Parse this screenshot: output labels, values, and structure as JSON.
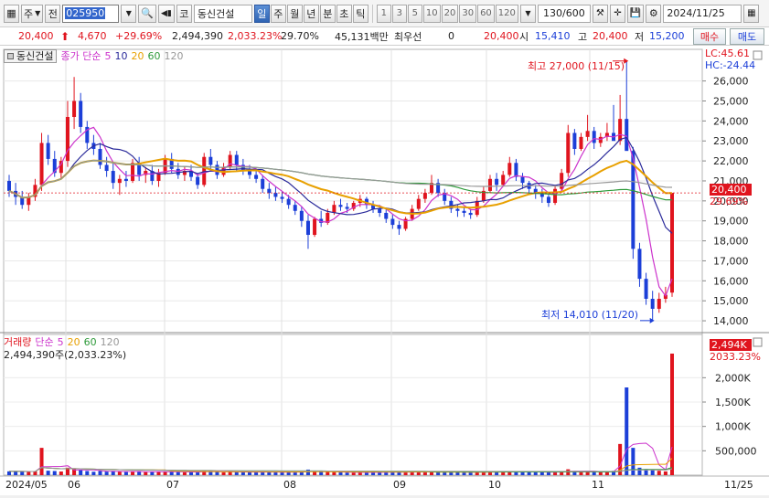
{
  "toolbar": {
    "market_label": "주",
    "prev_label": "전",
    "stock_code": "025950",
    "stock_name": "동신건설",
    "code_label": "코",
    "periods": [
      "일",
      "주",
      "월",
      "년",
      "분",
      "초",
      "틱"
    ],
    "active_period": "일",
    "intervals": [
      "1",
      "3",
      "5",
      "10",
      "20",
      "30",
      "60",
      "120"
    ],
    "count": "130/600",
    "date": "2024/11/25"
  },
  "quote": {
    "price": "20,400",
    "change": "4,670",
    "change_pct": "+29.69%",
    "volume": "2,494,390",
    "volume_ratio": "2,033.23%",
    "turnover": "29.70%",
    "amount": "45,131백만",
    "pref_label": "최우선",
    "pref_value": "0",
    "price_ref": "20,400",
    "open_label": "시",
    "open": "15,410",
    "high_label": "고",
    "high": "20,400",
    "low_label": "저",
    "low": "15,200",
    "buy_label": "매수",
    "sell_label": "매도"
  },
  "price_panel": {
    "legend_name": "동신건설",
    "legend_type": "종가 단순",
    "ma_periods": [
      "5",
      "10",
      "20",
      "60",
      "120"
    ],
    "lc_label": "LC:45.61",
    "hc_label": "HC:-24.44",
    "current_price_tag": "20,400",
    "current_pct_tag": "29.69%",
    "high_annotation": "최고 27,000 (11/15)",
    "low_annotation": "최저 14,010 (11/20)",
    "y_ticks": [
      "26,000",
      "25,000",
      "24,000",
      "23,000",
      "22,000",
      "21,000",
      "20,000",
      "19,000",
      "18,000",
      "17,000",
      "16,000",
      "15,000",
      "14,000"
    ]
  },
  "volume_panel": {
    "legend_title": "거래량",
    "legend_type": "단순",
    "ma_periods": [
      "5",
      "20",
      "60",
      "120"
    ],
    "volume_text": "2,494,390주(2,033.23%)",
    "volume_tag": "2,494K",
    "ratio_tag": "2033.23%",
    "y_ticks": [
      "2,000K",
      "1,500K",
      "1,000K",
      "500,000"
    ]
  },
  "x_axis": {
    "labels": [
      "2024/05",
      "06",
      "07",
      "08",
      "09",
      "10",
      "11",
      "11/25"
    ]
  },
  "colors": {
    "up": "#e0141e",
    "down": "#1c3fd8",
    "ma5": "#cc33cc",
    "ma10": "#2a2a9a",
    "ma20": "#e8a000",
    "ma60": "#2e9a3a",
    "ma120": "#999999"
  },
  "chart_data": {
    "type": "candlestick",
    "y_range": [
      13500,
      27400
    ],
    "daily_ohlc": [
      [
        21000,
        21300,
        20200,
        20500
      ],
      [
        20500,
        20900,
        19800,
        20200
      ],
      [
        20200,
        20500,
        19600,
        19800
      ],
      [
        19800,
        20400,
        19500,
        20200
      ],
      [
        20200,
        21100,
        20000,
        20800
      ],
      [
        20800,
        23400,
        20500,
        22900
      ],
      [
        22900,
        23300,
        21800,
        22100
      ],
      [
        22100,
        22500,
        21200,
        21400
      ],
      [
        21400,
        22200,
        21100,
        22000
      ],
      [
        22000,
        25000,
        21700,
        24200
      ],
      [
        24200,
        26200,
        23600,
        25000
      ],
      [
        25000,
        25400,
        23400,
        23700
      ],
      [
        23700,
        24000,
        22600,
        22900
      ],
      [
        22900,
        23300,
        22300,
        22600
      ],
      [
        22600,
        22900,
        21600,
        21800
      ],
      [
        21800,
        22200,
        21200,
        21500
      ],
      [
        21500,
        21900,
        20600,
        20900
      ],
      [
        20900,
        21300,
        20300,
        21100
      ],
      [
        21100,
        21500,
        20700,
        21000
      ],
      [
        21000,
        22100,
        20900,
        21900
      ],
      [
        21900,
        22200,
        21000,
        21300
      ],
      [
        21300,
        21700,
        20900,
        21500
      ],
      [
        21500,
        21800,
        20800,
        21000
      ],
      [
        21000,
        21600,
        20700,
        21400
      ],
      [
        21400,
        22300,
        21300,
        22100
      ],
      [
        22100,
        22400,
        21400,
        21600
      ],
      [
        21600,
        21900,
        21100,
        21300
      ],
      [
        21300,
        21700,
        21000,
        21500
      ],
      [
        21500,
        21800,
        21000,
        21200
      ],
      [
        21200,
        21400,
        20600,
        20800
      ],
      [
        20800,
        22400,
        20700,
        22200
      ],
      [
        22200,
        22600,
        21500,
        21800
      ],
      [
        21800,
        22000,
        21100,
        21300
      ],
      [
        21300,
        21900,
        21200,
        21700
      ],
      [
        21700,
        22500,
        21600,
        22300
      ],
      [
        22300,
        22500,
        21500,
        21800
      ],
      [
        21800,
        22100,
        21300,
        21500
      ],
      [
        21500,
        21800,
        21100,
        21300
      ],
      [
        21300,
        21600,
        20900,
        21100
      ],
      [
        21100,
        21300,
        20400,
        20600
      ],
      [
        20600,
        20900,
        20100,
        20400
      ],
      [
        20400,
        20700,
        20000,
        20200
      ],
      [
        20200,
        20500,
        19900,
        20100
      ],
      [
        20100,
        20300,
        19600,
        19800
      ],
      [
        19800,
        20000,
        19300,
        19500
      ],
      [
        19500,
        19700,
        18700,
        19000
      ],
      [
        19000,
        19300,
        17600,
        18300
      ],
      [
        18300,
        19200,
        18200,
        19100
      ],
      [
        19100,
        19500,
        18700,
        18900
      ],
      [
        18900,
        19600,
        18800,
        19400
      ],
      [
        19400,
        20000,
        19300,
        19800
      ],
      [
        19800,
        20100,
        19500,
        19700
      ],
      [
        19700,
        19900,
        19400,
        19600
      ],
      [
        19600,
        20000,
        19500,
        19900
      ],
      [
        19900,
        20300,
        19700,
        20100
      ],
      [
        20100,
        20200,
        19600,
        19800
      ],
      [
        19800,
        20000,
        19400,
        19600
      ],
      [
        19600,
        19800,
        19200,
        19400
      ],
      [
        19400,
        19600,
        18900,
        19100
      ],
      [
        19100,
        19300,
        18600,
        18800
      ],
      [
        18800,
        19000,
        18300,
        18600
      ],
      [
        18600,
        19200,
        18500,
        19100
      ],
      [
        19100,
        19800,
        19000,
        19600
      ],
      [
        19600,
        20300,
        19500,
        20100
      ],
      [
        20100,
        20600,
        19900,
        20400
      ],
      [
        20400,
        21300,
        20300,
        20900
      ],
      [
        20900,
        21100,
        20200,
        20400
      ],
      [
        20400,
        20600,
        19800,
        20000
      ],
      [
        20000,
        20200,
        19400,
        19600
      ],
      [
        19600,
        19800,
        19200,
        19500
      ],
      [
        19500,
        19700,
        19200,
        19400
      ],
      [
        19400,
        19600,
        19100,
        19300
      ],
      [
        19300,
        20200,
        19200,
        20000
      ],
      [
        20000,
        20700,
        19900,
        20500
      ],
      [
        20500,
        21300,
        20400,
        21100
      ],
      [
        21100,
        21400,
        20500,
        20800
      ],
      [
        20800,
        21500,
        20700,
        21300
      ],
      [
        21300,
        22200,
        21200,
        21900
      ],
      [
        21900,
        22100,
        21000,
        21200
      ],
      [
        21200,
        21400,
        20600,
        20900
      ],
      [
        20900,
        21000,
        20300,
        20600
      ],
      [
        20600,
        20800,
        20100,
        20400
      ],
      [
        20400,
        20600,
        19900,
        20200
      ],
      [
        20200,
        20300,
        19700,
        19900
      ],
      [
        19900,
        20800,
        19800,
        20600
      ],
      [
        20600,
        21600,
        20500,
        21400
      ],
      [
        21400,
        23800,
        21200,
        23400
      ],
      [
        23400,
        23600,
        22300,
        22600
      ],
      [
        22600,
        23400,
        22500,
        23200
      ],
      [
        23200,
        24300,
        23000,
        23500
      ],
      [
        23500,
        23700,
        22600,
        22900
      ],
      [
        22900,
        23400,
        22700,
        23200
      ],
      [
        23200,
        23900,
        23000,
        23400
      ],
      [
        23400,
        24800,
        23300,
        23000
      ],
      [
        23000,
        25300,
        22800,
        24100
      ],
      [
        24100,
        27000,
        23800,
        22500
      ],
      [
        22500,
        22700,
        17100,
        17600
      ],
      [
        17600,
        17900,
        15700,
        16100
      ],
      [
        16100,
        16400,
        14800,
        15100
      ],
      [
        15100,
        15500,
        14010,
        14600
      ],
      [
        14600,
        15400,
        14400,
        15100
      ],
      [
        15100,
        15700,
        14900,
        15300
      ],
      [
        15410,
        20400,
        15200,
        20400
      ]
    ],
    "volume_ratio_series": "volume per day relative",
    "high": {
      "value": 27000,
      "date": "11/15"
    },
    "low": {
      "value": 14010,
      "date": "11/20"
    }
  }
}
